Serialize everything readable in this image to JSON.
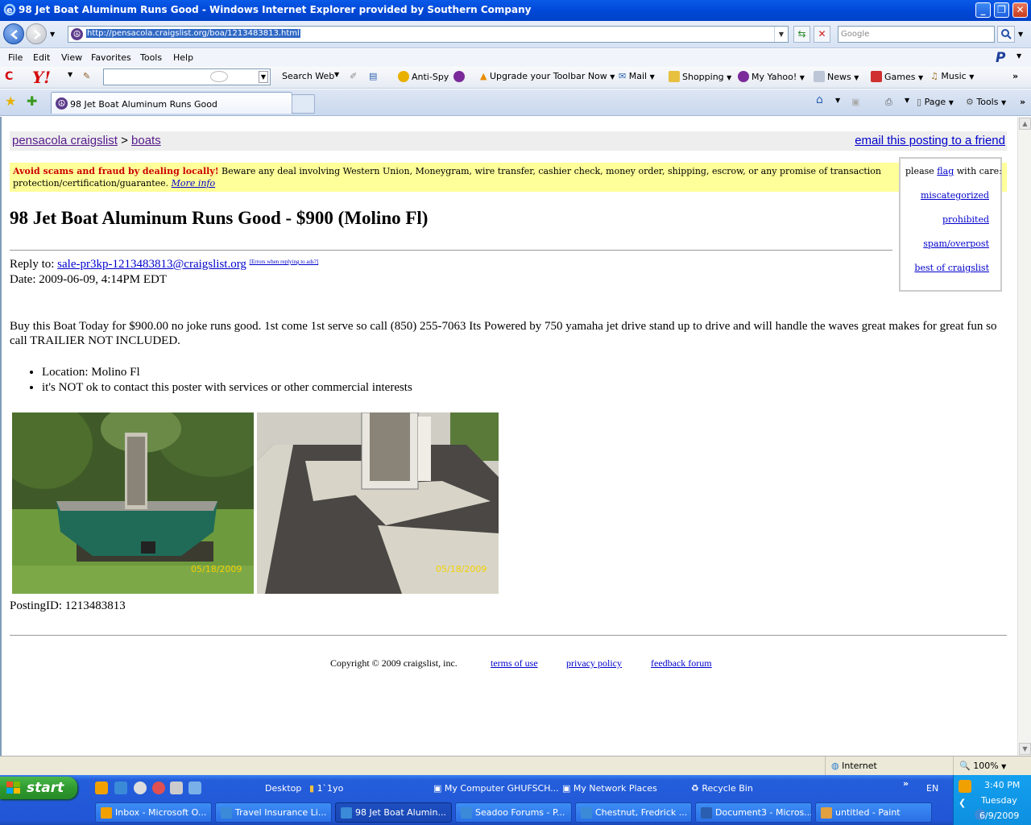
{
  "window": {
    "title": "98 Jet Boat Aluminum Runs Good - Windows Internet Explorer provided by Southern Company",
    "controls": {
      "minimize": "_",
      "restore": "❐",
      "close": "✕"
    }
  },
  "address_bar": {
    "url": "http://pensacola.craigslist.org/boa/1213483813.html",
    "search_placeholder": "Google"
  },
  "menu": [
    "File",
    "Edit",
    "View",
    "Favorites",
    "Tools",
    "Help"
  ],
  "paypal_logo": "P",
  "yahoo_toolbar": {
    "logo": "Y!",
    "search_web": "Search Web",
    "anti_spy": "Anti-Spy",
    "upgrade": "Upgrade your Toolbar Now",
    "mail": "Mail",
    "shopping": "Shopping",
    "my_yahoo": "My Yahoo!",
    "news": "News",
    "games": "Games",
    "music": "Music"
  },
  "tabs": {
    "active_tab": "98 Jet Boat Aluminum Runs Good",
    "commands": {
      "page": "Page",
      "tools": "Tools"
    }
  },
  "page": {
    "breadcrumb": {
      "site": "pensacola craigslist",
      "sep": ">",
      "category": "boats"
    },
    "email_friend": "email this posting to a friend",
    "scam_warning": {
      "bold": "Avoid scams and fraud by dealing locally!",
      "text": " Beware any deal involving Western Union, Moneygram, wire transfer, cashier check, money order, shipping, escrow, or any promise of transaction protection/certification/guarantee.",
      "more": "More info"
    },
    "flag_box": {
      "please": "please",
      "flag": "flag",
      "with_care": "with care:",
      "links": [
        "miscategorized",
        "prohibited",
        "spam/overpost",
        "best of craigslist"
      ]
    },
    "title": "98 Jet Boat Aluminum Runs Good - $900 (Molino Fl)",
    "reply_label": "Reply to:",
    "reply_email": "sale-pr3kp-1213483813@craigslist.org",
    "reply_errors": "[Errors when replying to ads?]",
    "date": "Date: 2009-06-09, 4:14PM EDT",
    "description": "Buy this Boat Today for $900.00 no joke runs good. 1st come 1st serve so call (850) 255-7063 Its Powered by 750 yamaha jet drive stand up to drive and will handle the waves great makes for great fun so call TRAILIER NOT INCLUDED.",
    "bullets": [
      "Location: Molino Fl",
      "it's NOT ok to contact this poster with services or other commercial interests"
    ],
    "photo_dates": [
      "05/18/2009",
      "05/18/2009"
    ],
    "posting_id": "PostingID: 1213483813",
    "footer": {
      "copyright": "Copyright © 2009 craigslist, inc.",
      "terms": "terms of use",
      "privacy": "privacy policy",
      "feedback": "feedback forum"
    }
  },
  "status_bar": {
    "zone": "Internet",
    "zoom": "100%"
  },
  "taskbar": {
    "start": "start",
    "desktop": "Desktop",
    "folder": "1`1yo",
    "my_computer": "My Computer GHUFSCH...",
    "network": "My Network Places",
    "recycle": "Recycle Bin",
    "lang": "EN",
    "buttons": [
      "Inbox - Microsoft O...",
      "Travel Insurance Li...",
      "98 Jet Boat Alumin...",
      "Seadoo Forums - P...",
      "Chestnut, Fredrick ...",
      "Document3 - Micros...",
      "untitled - Paint"
    ],
    "clock": {
      "time": "3:40 PM",
      "day": "Tuesday",
      "date": "6/9/2009"
    }
  },
  "colors": {
    "xp_blue": "#0048d8",
    "scam_yellow": "#ffff99",
    "warning_red": "#cc0000",
    "link_blue": "#0000cc",
    "visited_purple": "#551a8b"
  }
}
